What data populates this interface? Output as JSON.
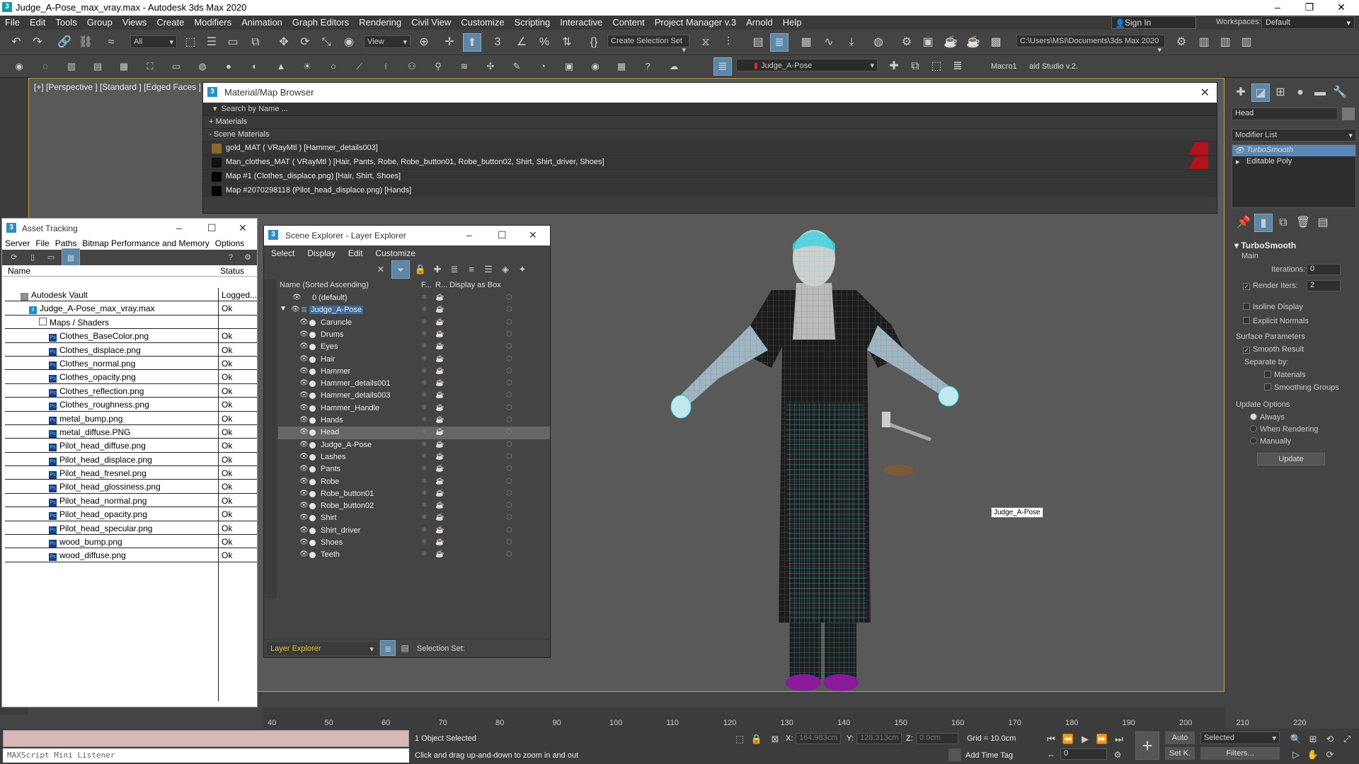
{
  "window": {
    "title": "Judge_A-Pose_max_vray.max - Autodesk 3ds Max 2020"
  },
  "menubar": {
    "items": [
      "File",
      "Edit",
      "Tools",
      "Group",
      "Views",
      "Create",
      "Modifiers",
      "Animation",
      "Graph Editors",
      "Rendering",
      "Civil View",
      "Customize",
      "Scripting",
      "Interactive",
      "Content",
      "Project Manager v.3",
      "Arnold",
      "Help"
    ],
    "signin": "Sign In",
    "workspaces_label": "Workspaces:",
    "workspace_value": "Default"
  },
  "toolbar": {
    "filter": "All",
    "view": "View",
    "selection_set": "Create Selection Set",
    "project_path": "C:\\Users\\MSI\\Documents\\3ds Max 2020",
    "layer": "Judge_A-Pose",
    "macro1": "Macro1",
    "macro2": "aid Studio v.2."
  },
  "viewport": {
    "label": "[+] [Perspective ] [Standard ] [Edged Faces ]",
    "tooltip": "Judge_A-Pose"
  },
  "material_browser": {
    "title": "Material/Map Browser",
    "search_placeholder": "Search by Name ...",
    "materials_section": "+ Materials",
    "scene_section": "- Scene Materials",
    "rows": [
      {
        "text": "gold_MAT  ( VRayMtl )  [Hammer_details003]",
        "color": "#8a6a2a"
      },
      {
        "text": "Man_clothes_MAT  ( VRayMtl )  [Hair, Pants, Robe, Robe_button01, Robe_button02, Shirt, Shirt_driver, Shoes]",
        "color": "#111111"
      },
      {
        "text": "Map #1 (Clothes_displace.png)  [Hair, Shirt, Shoes]",
        "color": "#000000"
      },
      {
        "text": "Map #2070298118 (Pilot_head_displace.png)  [Hands]",
        "color": "#000000"
      }
    ]
  },
  "asset_tracking": {
    "title": "Asset Tracking",
    "menu": [
      "Server",
      "File",
      "Paths",
      "Bitmap Performance and Memory",
      "Options"
    ],
    "col_name": "Name",
    "col_status": "Status",
    "rows": [
      {
        "name": "Autodesk Vault",
        "status": "Logged...",
        "indent": 14
      },
      {
        "name": "Judge_A-Pose_max_vray.max",
        "status": "Ok",
        "indent": 26
      },
      {
        "name": "Maps / Shaders",
        "status": "",
        "indent": 40
      },
      {
        "name": "Clothes_BaseColor.png",
        "status": "Ok",
        "indent": 54
      },
      {
        "name": "Clothes_displace.png",
        "status": "Ok",
        "indent": 54
      },
      {
        "name": "Clothes_normal.png",
        "status": "Ok",
        "indent": 54
      },
      {
        "name": "Clothes_opacity.png",
        "status": "Ok",
        "indent": 54
      },
      {
        "name": "Clothes_reflection.png",
        "status": "Ok",
        "indent": 54
      },
      {
        "name": "Clothes_roughness.png",
        "status": "Ok",
        "indent": 54
      },
      {
        "name": "metal_bump.png",
        "status": "Ok",
        "indent": 54
      },
      {
        "name": "metal_diffuse.PNG",
        "status": "Ok",
        "indent": 54
      },
      {
        "name": "Pilot_head_diffuse.png",
        "status": "Ok",
        "indent": 54
      },
      {
        "name": "Pilot_head_displace.png",
        "status": "Ok",
        "indent": 54
      },
      {
        "name": "Pilot_head_fresnel.png",
        "status": "Ok",
        "indent": 54
      },
      {
        "name": "Pilot_head_glossiness.png",
        "status": "Ok",
        "indent": 54
      },
      {
        "name": "Pilot_head_normal.png",
        "status": "Ok",
        "indent": 54
      },
      {
        "name": "Pilot_head_opacity.png",
        "status": "Ok",
        "indent": 54
      },
      {
        "name": "Pilot_head_specular.png",
        "status": "Ok",
        "indent": 54
      },
      {
        "name": "wood_bump.png",
        "status": "Ok",
        "indent": 54
      },
      {
        "name": "wood_diffuse.png",
        "status": "Ok",
        "indent": 54
      }
    ]
  },
  "scene_explorer": {
    "title": "Scene Explorer - Layer Explorer",
    "menu": [
      "Select",
      "Display",
      "Edit",
      "Customize"
    ],
    "col_name": "Name (Sorted Ascending)",
    "col_f": "F...",
    "col_r": "R...",
    "col_box": "Display as Box",
    "footer_mode": "Layer Explorer",
    "footer_selset": "Selection Set:",
    "rows": [
      {
        "name": "0 (default)",
        "level": 0
      },
      {
        "name": "Judge_A-Pose",
        "level": 0
      },
      {
        "name": "Caruncle",
        "level": 1
      },
      {
        "name": "Drums",
        "level": 1
      },
      {
        "name": "Eyes",
        "level": 1
      },
      {
        "name": "Hair",
        "level": 1
      },
      {
        "name": "Hammer",
        "level": 1
      },
      {
        "name": "Hammer_details001",
        "level": 1
      },
      {
        "name": "Hammer_details003",
        "level": 1
      },
      {
        "name": "Hammer_Handle",
        "level": 1
      },
      {
        "name": "Hands",
        "level": 1
      },
      {
        "name": "Head",
        "level": 1
      },
      {
        "name": "Judge_A-Pose",
        "level": 1
      },
      {
        "name": "Lashes",
        "level": 1
      },
      {
        "name": "Pants",
        "level": 1
      },
      {
        "name": "Robe",
        "level": 1
      },
      {
        "name": "Robe_button01",
        "level": 1
      },
      {
        "name": "Robe_button02",
        "level": 1
      },
      {
        "name": "Shirt",
        "level": 1
      },
      {
        "name": "Shirt_driver",
        "level": 1
      },
      {
        "name": "Shoes",
        "level": 1
      },
      {
        "name": "Teeth",
        "level": 1
      }
    ]
  },
  "command_panel": {
    "object_name": "Head",
    "modifier_list": "Modifier List",
    "stack": [
      "TurboSmooth",
      "Editable Poly"
    ],
    "rollout_title": "TurboSmooth",
    "main": "Main",
    "iterations_label": "Iterations:",
    "iterations": "0",
    "render_iters_label": "Render Iters:",
    "render_iters": "2",
    "isoline": "Isoline Display",
    "explicit_normals": "Explicit Normals",
    "surface_params": "Surface Parameters",
    "smooth_result": "Smooth Result",
    "separate_by": "Separate by:",
    "materials": "Materials",
    "smoothing_groups": "Smoothing Groups",
    "update_options": "Update Options",
    "always": "Always",
    "when_rendering": "When Rendering",
    "manually": "Manually",
    "update_btn": "Update"
  },
  "timeline": {
    "ticks": [
      "40",
      "50",
      "60",
      "70",
      "80",
      "90",
      "100",
      "110",
      "120",
      "130",
      "140",
      "150",
      "160",
      "170",
      "180",
      "190",
      "200",
      "210",
      "220"
    ]
  },
  "status": {
    "listener": "MAXScript Mini Listener",
    "selected": "1 Object Selected",
    "prompt": "Click and drag up-and-down to zoom in and out",
    "x_label": "X:",
    "x": "164.983cm",
    "y_label": "Y:",
    "y": "128.313cm",
    "z_label": "Z:",
    "z": "0.0cm",
    "grid": "Grid = 10.0cm",
    "add_time_tag": "Add Time Tag",
    "auto": "Auto",
    "setk": "Set K.",
    "selected_drop": "Selected",
    "filters": "Filters...",
    "frame": "0"
  }
}
